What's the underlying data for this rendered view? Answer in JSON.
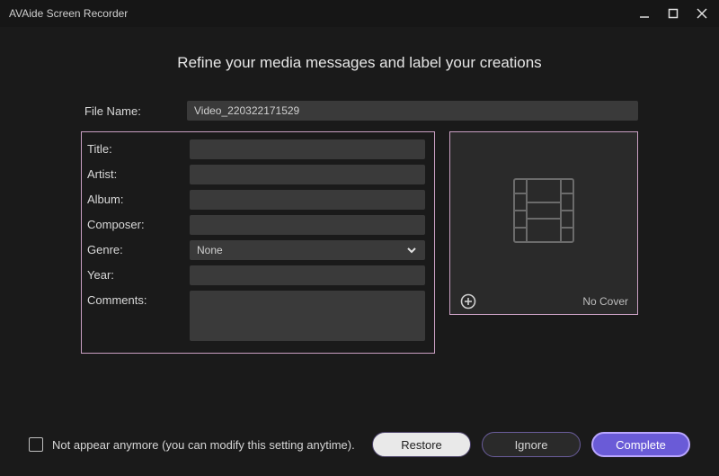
{
  "app": {
    "title": "AVAide Screen Recorder"
  },
  "heading": "Refine your media messages and label your creations",
  "labels": {
    "file_name": "File Name:",
    "title": "Title:",
    "artist": "Artist:",
    "album": "Album:",
    "composer": "Composer:",
    "genre": "Genre:",
    "year": "Year:",
    "comments": "Comments:"
  },
  "values": {
    "file_name": "Video_220322171529",
    "title": "",
    "artist": "",
    "album": "",
    "composer": "",
    "genre": "None",
    "year": "",
    "comments": ""
  },
  "cover": {
    "no_cover": "No Cover"
  },
  "footer": {
    "checkbox_label": "Not appear anymore (you can modify this setting anytime).",
    "restore": "Restore",
    "ignore": "Ignore",
    "complete": "Complete"
  }
}
